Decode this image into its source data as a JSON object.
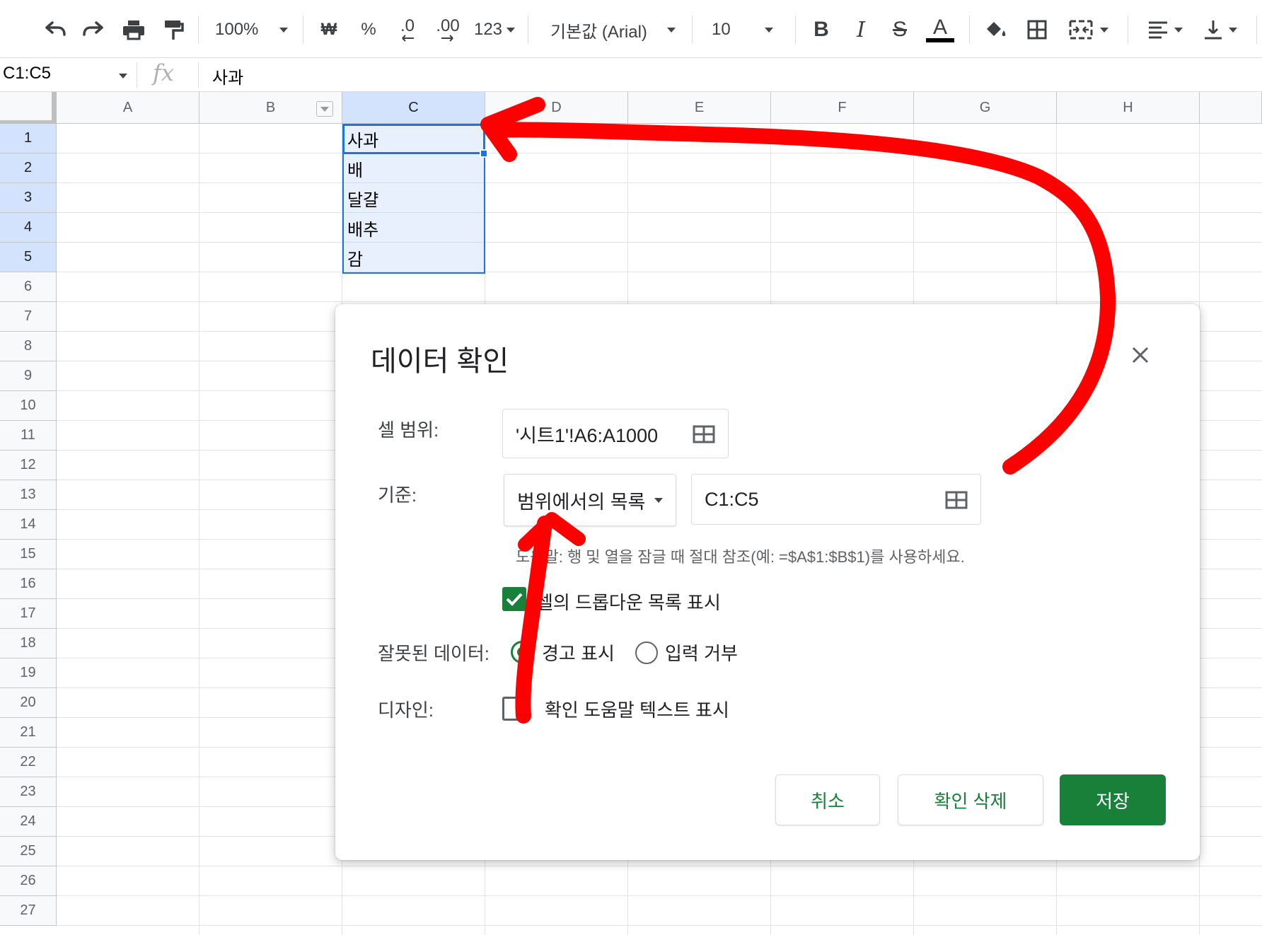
{
  "toolbar": {
    "zoom": "100%",
    "currency": "₩",
    "percent": "%",
    "dec_less": ".0",
    "dec_more": ".00",
    "format_more": "123",
    "font": "기본값 (Arial)",
    "font_size": "10",
    "bold": "B",
    "italic": "I",
    "strike": "S",
    "text_color": "A"
  },
  "formula_bar": {
    "name_box": "C1:C5",
    "fx": "fx",
    "value": "사과"
  },
  "columns": [
    "A",
    "B",
    "C",
    "D",
    "E",
    "F",
    "G",
    "H"
  ],
  "rows": [
    "1",
    "2",
    "3",
    "4",
    "5",
    "6",
    "7",
    "8",
    "9",
    "10",
    "11",
    "12",
    "13",
    "14",
    "15",
    "16",
    "17",
    "18",
    "19",
    "20",
    "21",
    "22",
    "23",
    "24",
    "25",
    "26",
    "27"
  ],
  "cells_c": [
    "사과",
    "배",
    "달걀",
    "배추",
    "감"
  ],
  "dialog": {
    "title": "데이터 확인",
    "range_label": "셀 범위:",
    "range_value": "'시트1'!A6:A1000",
    "criteria_label": "기준:",
    "criteria_type": "범위에서의 목록",
    "criteria_range": "C1:C5",
    "hint": "도움말: 행 및 열을 잠글 때 절대 참조(예: =$A$1:$B$1)를 사용하세요.",
    "show_dropdown": "셀의 드롭다운 목록 표시",
    "invalid_label": "잘못된 데이터:",
    "invalid_warn": "경고 표시",
    "invalid_reject": "입력 거부",
    "design_label": "디자인:",
    "design_help": "확인 도움말 텍스트 표시",
    "cancel": "취소",
    "remove": "확인 삭제",
    "save": "저장"
  },
  "colors": {
    "accent_green": "#188038",
    "selection_blue": "#1a73e8",
    "annotation_red": "#ff0000"
  }
}
